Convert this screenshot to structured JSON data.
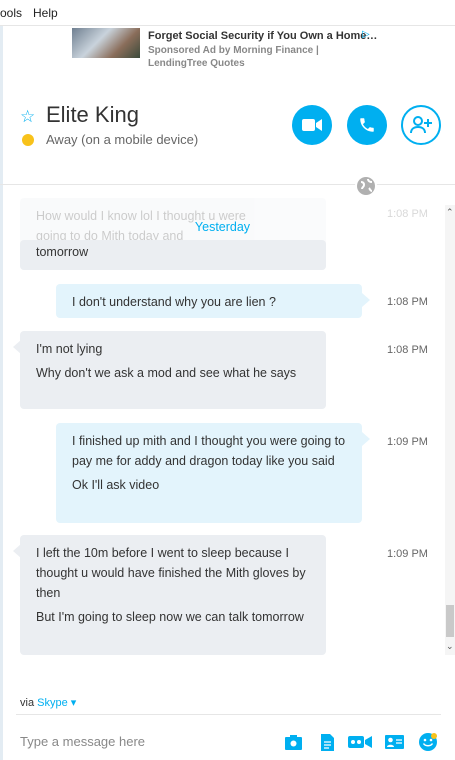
{
  "menu": {
    "items": [
      "ools",
      "Help"
    ]
  },
  "ad": {
    "title": "Forget Social Security if You Own a Home…",
    "subtitle": "Sponsored Ad by Morning Finance | LendingTree Quotes"
  },
  "contact": {
    "name": "Elite King",
    "status": "Away (on a mobile device)"
  },
  "chat": {
    "date_separator": "Yesterday",
    "faded_message": [
      "How would I know lol I thought u were",
      "going to do Mith today and",
      "tomorrow"
    ],
    "messages": [
      {
        "dir": "out",
        "lines": [
          "I don't understand why you are lien ?"
        ],
        "time": "1:08 PM"
      },
      {
        "dir": "in",
        "lines": [
          "I'm not lying",
          "Why don't we ask a mod and see what he says"
        ],
        "time": "1:08 PM"
      },
      {
        "dir": "out",
        "lines": [
          "I finished up mith and I thought you were going to pay me for addy and dragon today like you said",
          "Ok I'll ask video"
        ],
        "time": "1:09 PM"
      },
      {
        "dir": "in",
        "lines": [
          "I left the 10m before I went to sleep because I thought u would have finished the Mith gloves by then",
          "But I'm going to sleep now we can talk tomorrow"
        ],
        "time": "1:09 PM"
      }
    ],
    "faded_time": "1:08 PM"
  },
  "footer": {
    "via_prefix": "via",
    "via_link": "Skype",
    "compose_placeholder": "Type a message here"
  },
  "colors": {
    "accent": "#00aff0",
    "away": "#f8c21b"
  }
}
